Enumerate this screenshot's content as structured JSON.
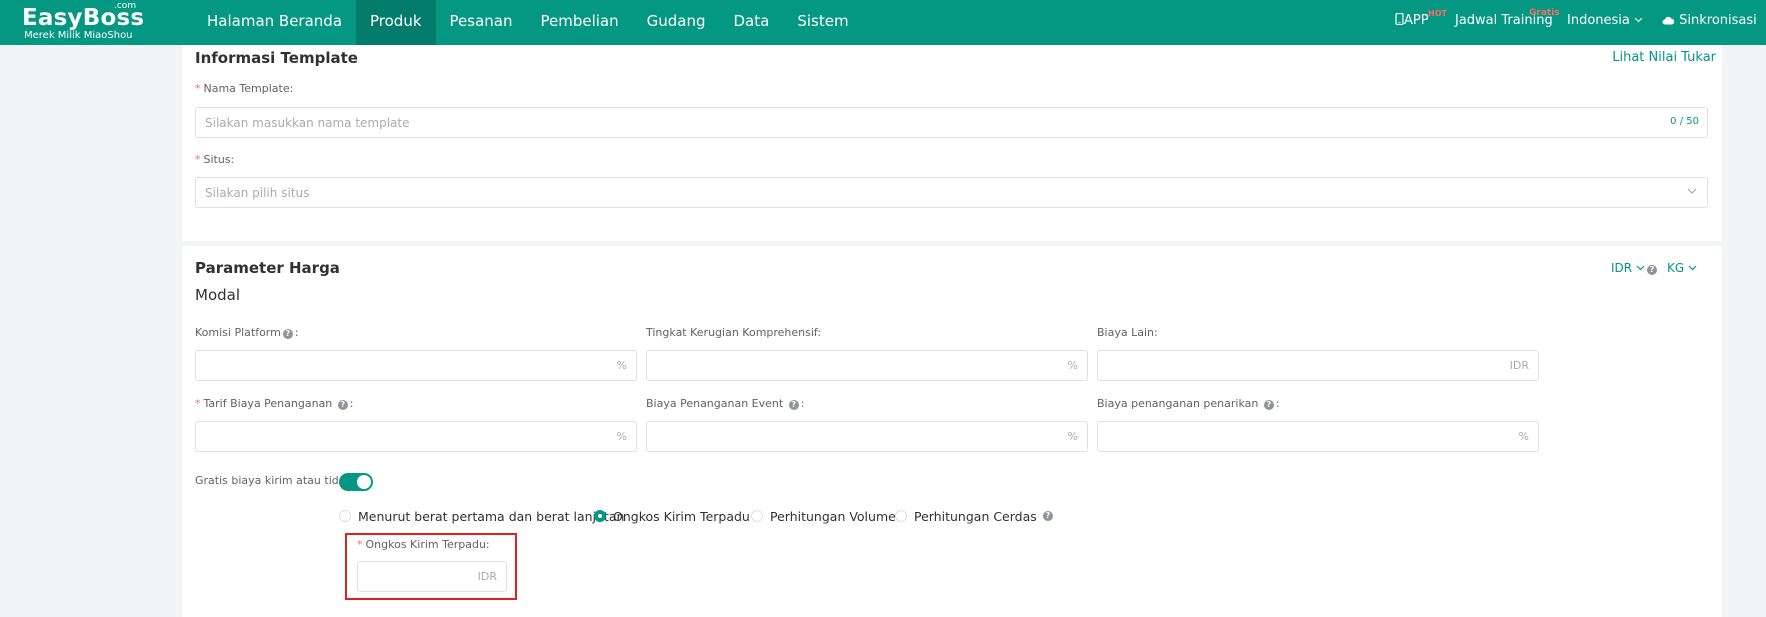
{
  "header": {
    "logo": {
      "brand": "EasyBoss",
      "com": ".com",
      "subtitle": "Merek Milik MiaoShou"
    },
    "nav": [
      {
        "label": "Halaman Beranda",
        "active": false
      },
      {
        "label": "Produk",
        "active": true
      },
      {
        "label": "Pesanan",
        "active": false
      },
      {
        "label": "Pembelian",
        "active": false
      },
      {
        "label": "Gudang",
        "active": false
      },
      {
        "label": "Data",
        "active": false
      },
      {
        "label": "Sistem",
        "active": false
      }
    ],
    "app_label": "APP",
    "app_badge": "HOT",
    "training_label": "Jadwal Training",
    "training_badge": "Gratis",
    "language": "Indonesia",
    "sync_label": "Sinkronisasi"
  },
  "template_section": {
    "title": "Informasi Template",
    "exchange_link": "Lihat Nilai Tukar",
    "name_label": "Nama Template:",
    "name_placeholder": "Silakan masukkan nama template",
    "name_counter": "0 / 50",
    "site_label": "Situs:",
    "site_placeholder": "Silakan pilih situs"
  },
  "price_section": {
    "title": "Parameter Harga",
    "currency": "IDR",
    "weight_unit": "KG",
    "subtitle": "Modal",
    "fields": [
      {
        "label": "Komisi Platform",
        "help": true,
        "required": false,
        "suffix": "%"
      },
      {
        "label": "Tingkat Kerugian Komprehensif:",
        "help": false,
        "required": false,
        "suffix": "%"
      },
      {
        "label": "Biaya Lain:",
        "help": false,
        "required": false,
        "suffix": "IDR"
      },
      {
        "label": "Tarif Biaya Penanganan",
        "help": true,
        "required": true,
        "suffix": "%"
      },
      {
        "label": "Biaya Penanganan Event",
        "help": true,
        "required": false,
        "suffix": "%"
      },
      {
        "label": "Biaya penanganan penarikan",
        "help": true,
        "required": false,
        "suffix": "%"
      }
    ],
    "free_shipping_label": "Gratis biaya kirim atau tidak:",
    "free_shipping_on": true,
    "shipping_options": [
      {
        "label": "Menurut berat pertama dan berat lanjutan",
        "checked": false
      },
      {
        "label": "Ongkos Kirim Terpadu",
        "checked": true
      },
      {
        "label": "Perhitungan Volume",
        "checked": false
      },
      {
        "label": "Perhitungan Cerdas",
        "checked": false,
        "help": true
      }
    ],
    "unified_label": "Ongkos Kirim Terpadu:",
    "unified_suffix": "IDR"
  },
  "colors": {
    "brand": "#049781",
    "required": "#f56c6c",
    "highlight": "#e02020"
  }
}
